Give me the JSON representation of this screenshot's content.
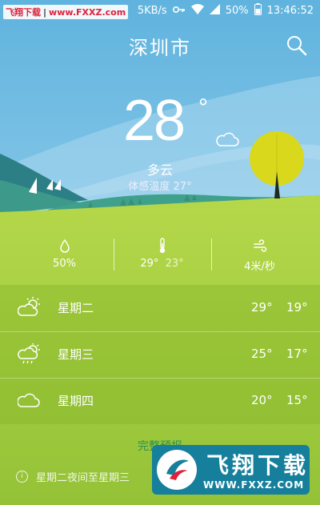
{
  "status_bar": {
    "watermark_name": "飞翔下载",
    "watermark_url": "www.FXXZ.com",
    "network_speed": "5KB/s",
    "battery": "50%",
    "time": "13:46:52"
  },
  "header": {
    "city": "深圳市"
  },
  "current": {
    "temperature": "28",
    "degree_symbol": "°",
    "condition": "多云",
    "feels_like": "体感温度 27°"
  },
  "metrics": {
    "humidity": "50%",
    "temp_high": "29°",
    "temp_low": "23°",
    "wind": "4米/秒"
  },
  "forecast": [
    {
      "day": "星期二",
      "high": "29°",
      "low": "19°",
      "icon": "partly-cloudy-icon"
    },
    {
      "day": "星期三",
      "high": "25°",
      "low": "17°",
      "icon": "cloudy-rain-icon"
    },
    {
      "day": "星期四",
      "high": "20°",
      "low": "15°",
      "icon": "cloud-icon"
    }
  ],
  "full_forecast_label": "完整预报",
  "alert_text": "星期二夜间至星期三",
  "watermark_logo": {
    "title": "飞翔下载",
    "url": "WWW.FXXZ.COM"
  },
  "colors": {
    "sky_top": "#7fc4e6",
    "grass": "#9cc63a",
    "tree": "#d7d51b",
    "link": "#2e8f52"
  }
}
